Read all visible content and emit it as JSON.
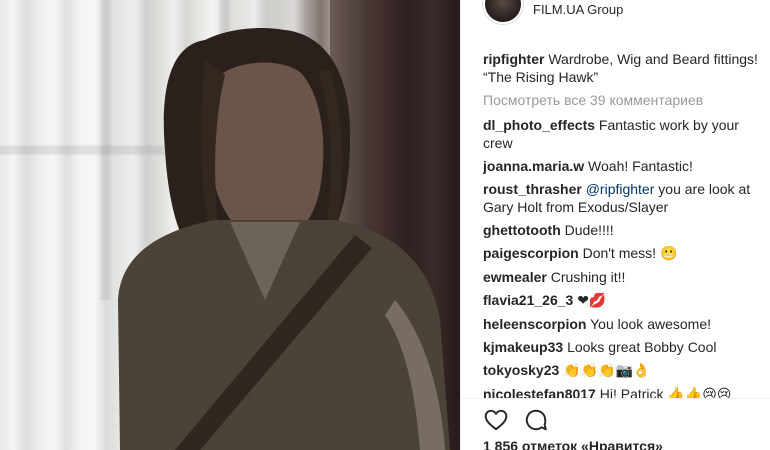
{
  "post": {
    "location": "FILM.UA Group",
    "author": "ripfighter",
    "caption_before": "Wardrobe, Wig and Beard fittings! ",
    "caption_quote": "“The Rising Hawk”",
    "view_all_comments": "Посмотреть все 39 комментариев",
    "likes": "1 856 отметок «Нравится»"
  },
  "comments": [
    {
      "user": "dl_photo_effects",
      "text": "Fantastic work by your crew"
    },
    {
      "user": "joanna.maria.w",
      "text": "Woah! Fantastic!"
    },
    {
      "user": "roust_thrasher",
      "mention": "@ripfighter",
      "text": " you are look at Gary Holt from Exodus/Slayer"
    },
    {
      "user": "ghettotooth",
      "text": "Dude!!!!"
    },
    {
      "user": "paigescorpion",
      "text": "Don't mess! ",
      "emoji": "😬"
    },
    {
      "user": "ewmealer",
      "text": "Crushing it!!"
    },
    {
      "user": "flavia21_26_3",
      "text": "",
      "emoji": "❤💋"
    },
    {
      "user": "heleenscorpion",
      "text": "You look awesome!"
    },
    {
      "user": "kjmakeup33",
      "text": "Looks great Bobby Cool"
    },
    {
      "user": "tokyosky23",
      "text": "",
      "emoji": "👏👏👏📷👌"
    },
    {
      "user": "nicolestefan8017",
      "text": "Hi! Patrick ",
      "emoji": "👍👍😢😢"
    }
  ],
  "icons": {
    "heart": "heart-icon",
    "comment": "comment-icon"
  },
  "colors": {
    "username": "#262626",
    "muted": "#999999",
    "mention": "#003569"
  }
}
